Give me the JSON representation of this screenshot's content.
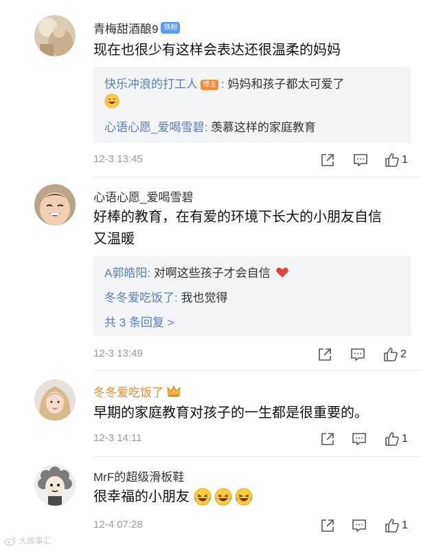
{
  "comments": [
    {
      "user": "青梅甜酒酿9",
      "badge": "铁粉",
      "text": "现在也很少有这样会表达还很温柔的妈妈",
      "replies": [
        {
          "user": "快乐冲浪的打工人",
          "tag": "博主",
          "text": "妈妈和孩子都太可爱了"
        },
        {
          "user": "心语心愿_爱喝雪碧",
          "text": "羡慕这样的家庭教育"
        }
      ],
      "time": "12-3 13:45",
      "likes": "1"
    },
    {
      "user": "心语心愿_爱喝雪碧",
      "text_line1": "好棒的教育，在有爱的环境下长大的小朋友自信",
      "text_line2": "又温暖",
      "replies": [
        {
          "user": "A郭皓阳",
          "text": "对啊这些孩子才会自信"
        },
        {
          "user": "冬冬爱吃饭了",
          "text": "我也觉得"
        }
      ],
      "more": "共 3 条回复 >",
      "time": "12-3 13:49",
      "likes": "2"
    },
    {
      "user": "冬冬爱吃饭了",
      "text": "早期的家庭教育对孩子的一生都是很重要的。",
      "time": "12-3 14:11",
      "likes": "1"
    },
    {
      "user": "MrF的超级滑板鞋",
      "text": "很幸福的小朋友",
      "time": "12-4 07:28",
      "likes": "1"
    }
  ],
  "reply_separator": ":",
  "watermark": "大故事汇",
  "colors": {
    "link_blue": "#5a7fb8",
    "orange_name": "#e8882c",
    "reply_bg": "#f3f4f6",
    "meta_gray": "#9a9a9a"
  }
}
